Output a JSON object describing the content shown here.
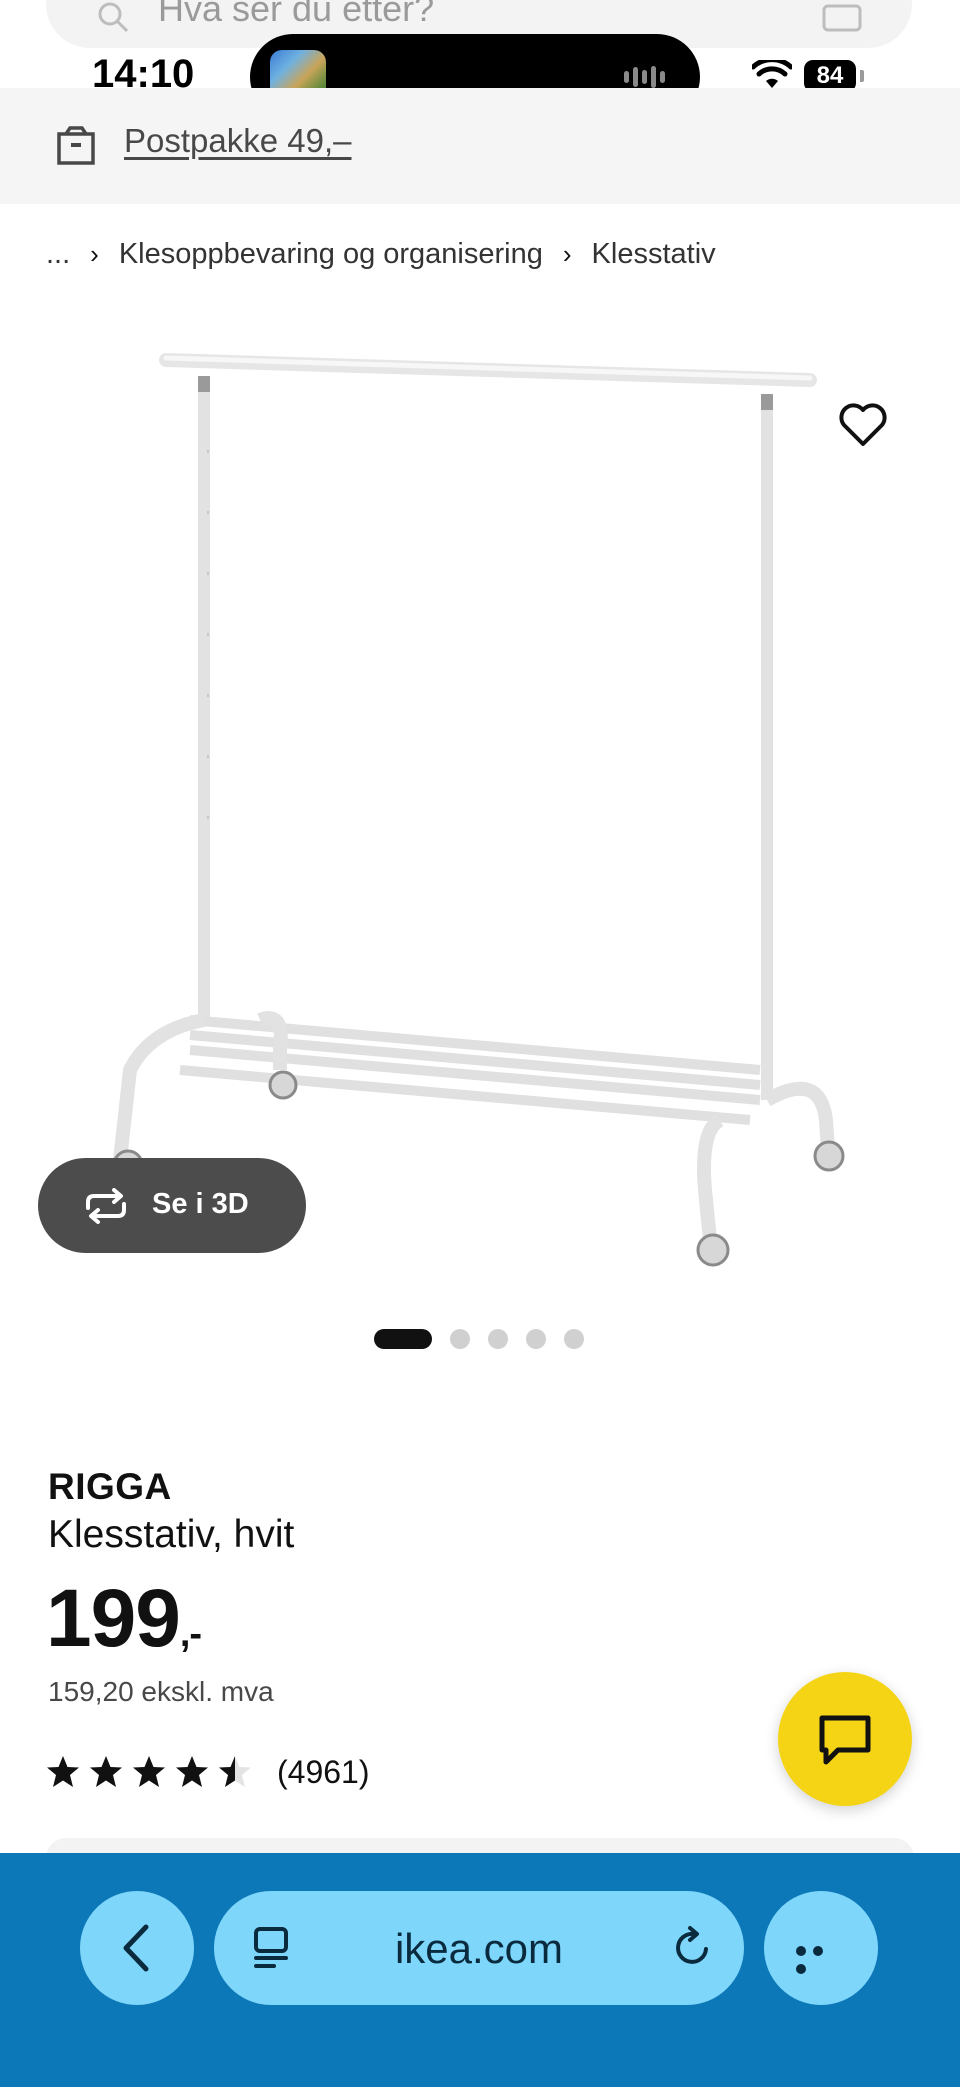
{
  "status_bar": {
    "time": "14:10",
    "battery": "84",
    "search_placeholder": "Hva ser du etter?"
  },
  "delivery": {
    "link": "Postpakke 49,–"
  },
  "breadcrumb": {
    "ellipsis": "...",
    "items": [
      "Klesoppbevaring og organisering",
      "Klesstativ"
    ]
  },
  "image": {
    "view3d_label": "Se i 3D",
    "pager_count": 5,
    "pager_active": 0
  },
  "product": {
    "brand": "RIGGA",
    "description": "Klesstativ, hvit",
    "price": "199",
    "price_suffix": ",-",
    "price_excl_vat": "159,20 ekskl. mva",
    "rating": 4.5,
    "rating_count": "(4961)"
  },
  "browser": {
    "url": "ikea.com"
  },
  "colors": {
    "chat_fab": "#f5d415",
    "browser_bar": "#0d78b8",
    "browser_button": "#7ed6fb"
  }
}
